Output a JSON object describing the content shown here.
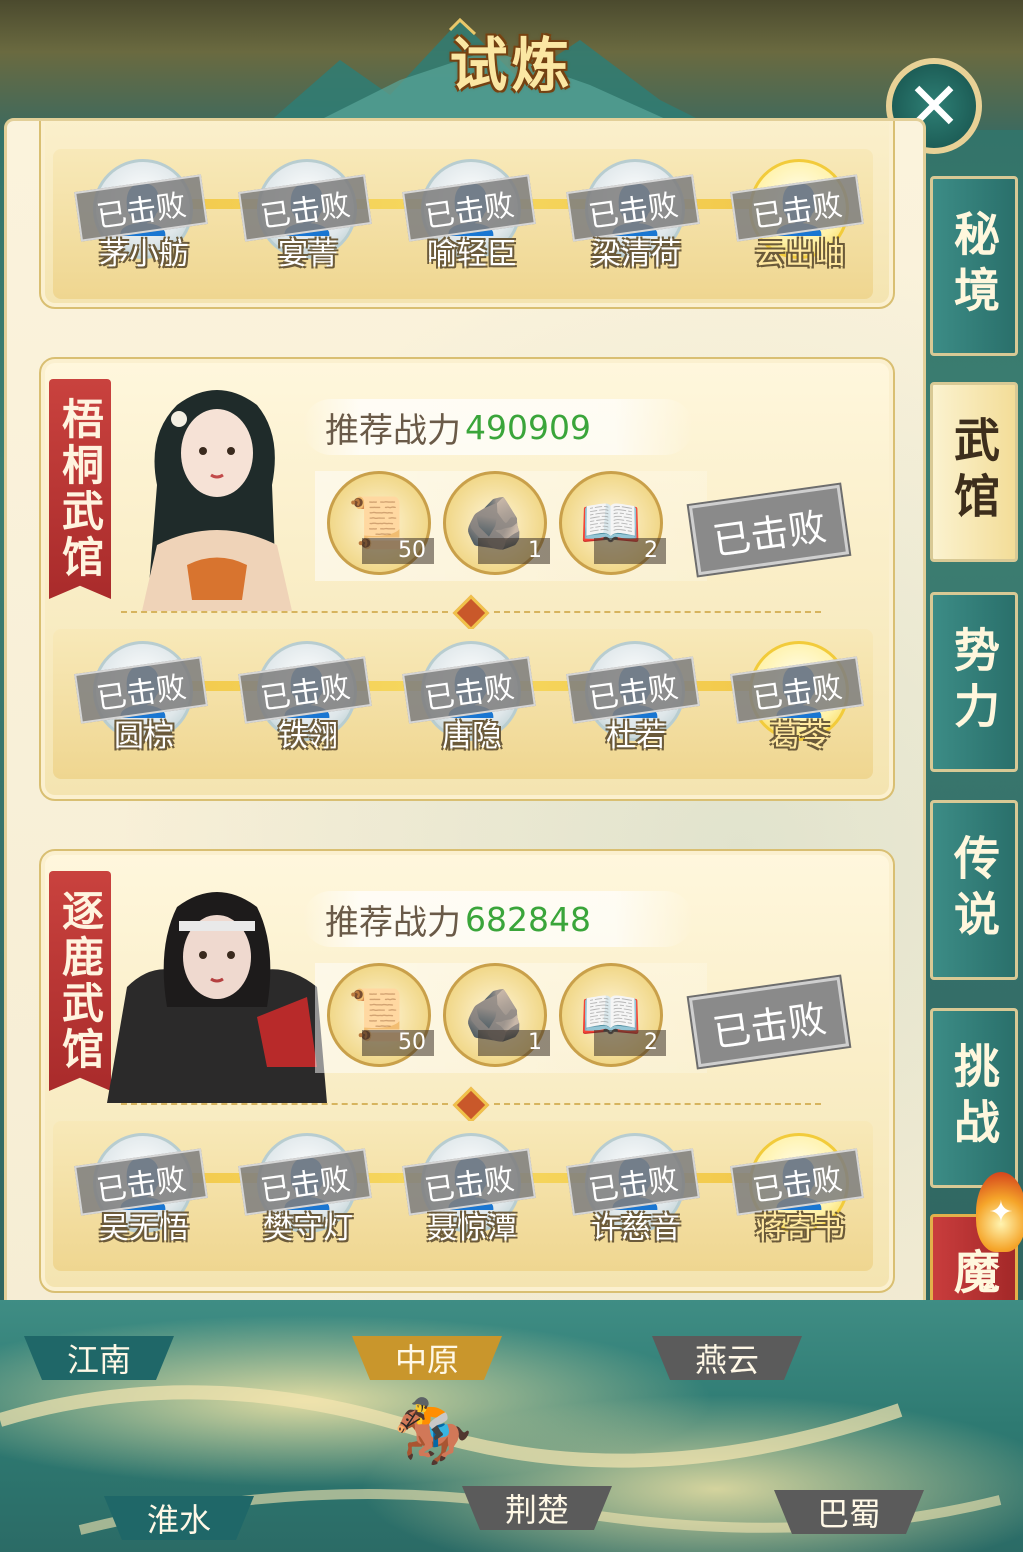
{
  "header": {
    "title": "试炼",
    "close_icon": "close-icon"
  },
  "top_card": {
    "fighters": [
      {
        "name": "茅小舫",
        "status": "已击败",
        "icon": "person-icon",
        "highlight": false
      },
      {
        "name": "宴菁",
        "status": "已击败",
        "icon": "person-icon",
        "highlight": false
      },
      {
        "name": "喻轻臣",
        "status": "已击败",
        "icon": "person-icon",
        "highlight": false
      },
      {
        "name": "梁清荷",
        "status": "已击败",
        "icon": "person-icon",
        "highlight": false
      },
      {
        "name": "云出岫",
        "status": "已击败",
        "icon": "person-icon",
        "highlight": true
      }
    ]
  },
  "halls": [
    {
      "name": "梧桐武馆",
      "power_label": "推荐战力",
      "power_value": "490909",
      "rewards": [
        {
          "icon": "scroll-icon",
          "count": "50"
        },
        {
          "icon": "gold-ore-icon",
          "count": "1"
        },
        {
          "icon": "book-fan-icon",
          "count": "2"
        }
      ],
      "status": "已击败",
      "fighters": [
        {
          "name": "圆棕",
          "status": "已击败"
        },
        {
          "name": "铁翎",
          "status": "已击败"
        },
        {
          "name": "唐隐",
          "status": "已击败"
        },
        {
          "name": "杜若",
          "status": "已击败"
        },
        {
          "name": "葛苓",
          "status": "已击败"
        }
      ]
    },
    {
      "name": "逐鹿武馆",
      "power_label": "推荐战力",
      "power_value": "682848",
      "rewards": [
        {
          "icon": "scroll-icon",
          "count": "50"
        },
        {
          "icon": "gold-ore-icon",
          "count": "1"
        },
        {
          "icon": "book-fan-icon",
          "count": "2"
        }
      ],
      "status": "已击败",
      "fighters": [
        {
          "name": "吴无悟",
          "status": "已击败"
        },
        {
          "name": "樊守灯",
          "status": "已击败"
        },
        {
          "name": "聂惊潭",
          "status": "已击败"
        },
        {
          "name": "许慈音",
          "status": "已击败"
        },
        {
          "name": "蒋寄书",
          "status": "已击败"
        }
      ]
    }
  ],
  "tabs": [
    {
      "label": "秘境",
      "active": false
    },
    {
      "label": "武馆",
      "active": true
    },
    {
      "label": "势力",
      "active": false
    },
    {
      "label": "传说",
      "active": false
    },
    {
      "label": "挑战",
      "active": false
    },
    {
      "label": "魔人",
      "active": false
    }
  ],
  "map": {
    "regions": [
      "江南",
      "中原",
      "燕云",
      "淮水",
      "荆楚",
      "巴蜀"
    ],
    "selected": "中原"
  },
  "colors": {
    "accent_teal": "#2a706b",
    "accent_gold": "#c9962c",
    "power_green": "#3aa53a",
    "hall_red": "#a92b2b"
  }
}
